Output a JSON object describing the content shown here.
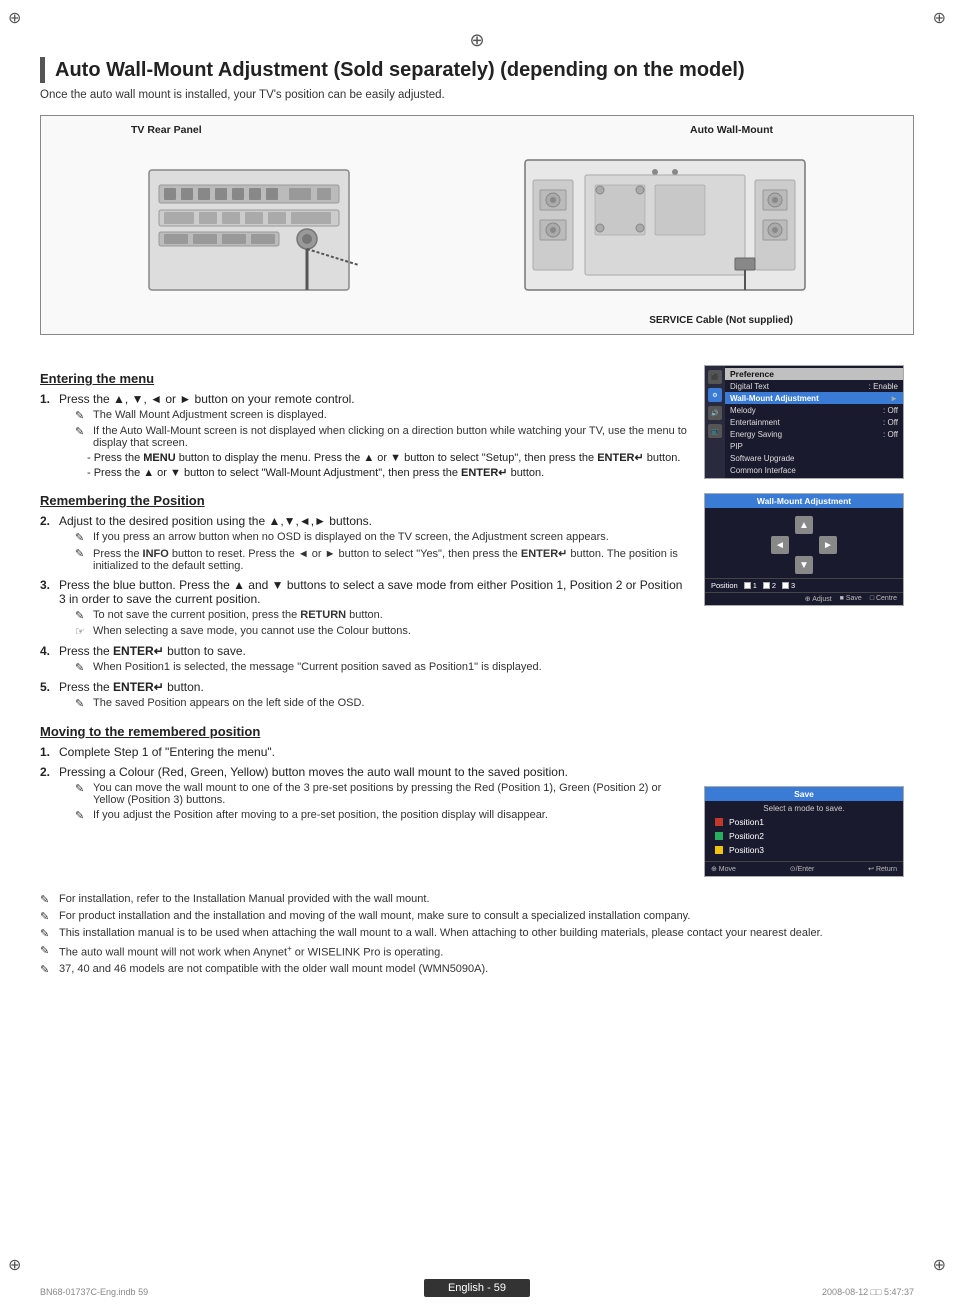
{
  "page": {
    "title": "Auto Wall-Mount Adjustment (Sold separately) (depending on the model)",
    "subtitle": "Once the auto wall mount is installed, your TV's position can be easily adjusted.",
    "diagram": {
      "label_tv": "TV Rear Panel",
      "label_wall": "Auto Wall-Mount",
      "label_service": "SERVICE Cable (Not supplied)"
    },
    "sections": {
      "entering_menu": {
        "heading": "Entering the menu",
        "step1": {
          "num": "1.",
          "text": "Press the ▲, ▼, ◄ or ► button on your remote control.",
          "notes": [
            "The Wall Mount Adjustment screen is displayed.",
            "If the Auto Wall-Mount screen is not displayed when clicking on a direction button while watching your TV, use the menu to display that screen.",
            "Press the MENU button to display the menu. Press the ▲ or ▼ button to select \"Setup\", then press the ENTER↵ button.",
            "Press the ▲ or ▼ button to select \"Wall-Mount Adjustment\", then press the ENTER↵ button."
          ]
        }
      },
      "remembering": {
        "heading": "Remembering the Position",
        "step2": {
          "num": "2.",
          "text": "Adjust to the desired position using the ▲,▼,◄,► buttons.",
          "notes": [
            "If you press an arrow button when no OSD is displayed on the TV screen, the Adjustment screen appears.",
            "Press the INFO button to reset. Press the ◄ or ► button to select \"Yes\", then press the ENTER↵ button. The position is initialized to the default setting."
          ]
        },
        "step3": {
          "num": "3.",
          "text": "Press the blue button. Press the ▲ and ▼ buttons to select a save mode from either Position 1, Position 2 or Position 3 in order to save the current position.",
          "notes": [
            "To not save the current position, press the RETURN button.",
            "When selecting a save mode, you cannot use the Colour buttons."
          ]
        },
        "step4": {
          "num": "4.",
          "text": "Press the ENTER↵ button to save.",
          "notes": [
            "When Position1 is selected, the message \"Current position saved as Position1\" is displayed."
          ]
        },
        "step5": {
          "num": "5.",
          "text": "Press the ENTER↵ button.",
          "notes": [
            "The saved Position appears on the left side of the OSD."
          ]
        }
      },
      "moving": {
        "heading": "Moving to the remembered position",
        "step1": {
          "num": "1.",
          "text": "Complete Step 1 of \"Entering the menu\"."
        },
        "step2": {
          "num": "2.",
          "text": "Pressing a Colour (Red, Green, Yellow) button moves the auto wall mount to the saved position.",
          "notes": [
            "You can move the wall mount to one of the 3 pre-set positions by pressing the Red (Position 1), Green (Position 2) or Yellow (Position 3) buttons.",
            "If you adjust the Position after moving to a pre-set position, the position display will disappear."
          ]
        }
      }
    },
    "bottom_notes": [
      "For installation, refer to the Installation Manual provided with the wall mount.",
      "For product installation and the installation and moving of the wall mount, make sure to consult a specialized installation company.",
      "This installation manual is to be used when attaching the wall mount to a wall. When attaching to other building materials, please contact your nearest dealer.",
      "The auto wall mount will not work when Anynet+ or WISELINK Pro is operating.",
      "37, 40 and 46 models are not compatible with the older wall mount model (WMN5090A)."
    ],
    "footer": {
      "badge": "English - 59",
      "left": "BN68-01737C-Eng.indb   59",
      "right": "2008-08-12   □□ 5:47:37"
    },
    "menu_screenshot": {
      "title": "Preference",
      "items": [
        {
          "label": "Digital Text",
          "value": ": Enable",
          "highlighted": false
        },
        {
          "label": "Wall-Mount Adjustment",
          "value": "►",
          "highlighted": true
        },
        {
          "label": "Melody",
          "value": ": Off",
          "highlighted": false
        },
        {
          "label": "Entertainment",
          "value": ": Off",
          "highlighted": false
        },
        {
          "label": "Energy Saving",
          "value": ": Off",
          "highlighted": false
        },
        {
          "label": "PIP",
          "value": "",
          "highlighted": false
        },
        {
          "label": "Software Upgrade",
          "value": "",
          "highlighted": false
        },
        {
          "label": "Common Interface",
          "value": "",
          "highlighted": false
        }
      ]
    },
    "wma_screenshot": {
      "title": "Wall-Mount Adjustment",
      "positions_label": "Position",
      "positions": [
        "1",
        "2",
        "3"
      ],
      "footer_items": [
        "Adjust",
        "Save",
        "Centre"
      ]
    },
    "save_screenshot": {
      "title": "Save",
      "subtitle": "Select a mode to save.",
      "items": [
        {
          "label": "Position1",
          "color": "red"
        },
        {
          "label": "Position2",
          "color": "green"
        },
        {
          "label": "Position3",
          "color": "yellow"
        }
      ],
      "footer": {
        "move": "Move",
        "enter": "Enter",
        "return": "Return"
      }
    }
  }
}
